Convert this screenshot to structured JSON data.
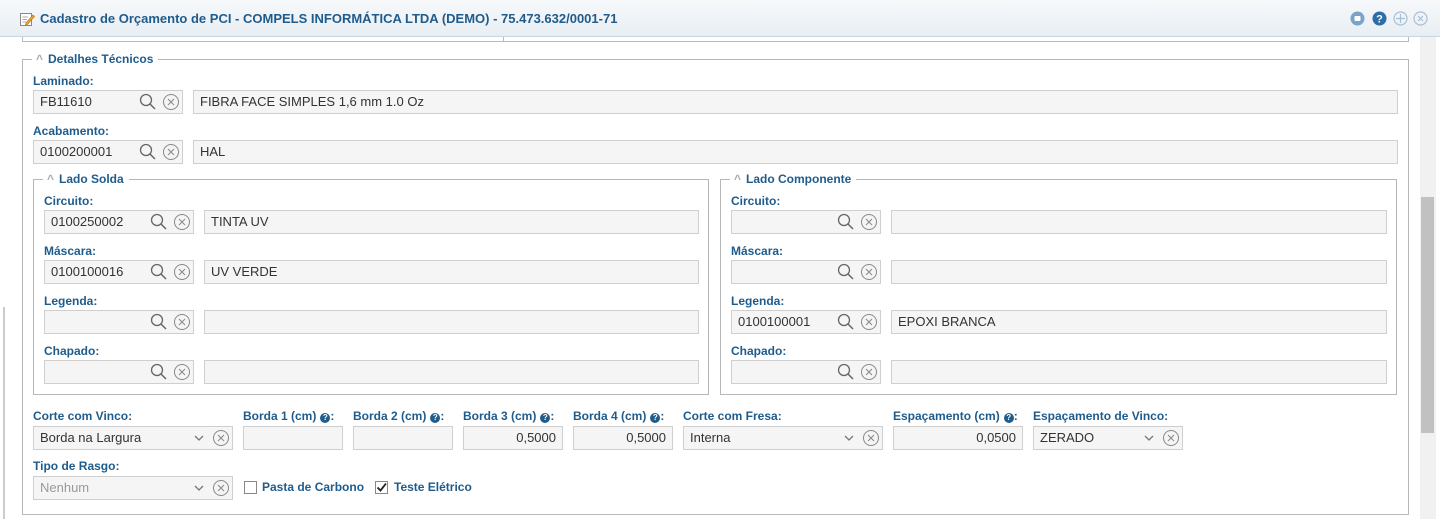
{
  "window": {
    "title": "Cadastro de Orçamento de PCI - COMPELS INFORMÁTICA LTDA (DEMO) - 75.473.632/0001-71"
  },
  "detalhes": {
    "legend": "Detalhes Técnicos",
    "laminado": {
      "label": "Laminado:",
      "code": "FB11610",
      "desc": "FIBRA FACE SIMPLES 1,6 mm 1.0 Oz"
    },
    "acabamento": {
      "label": "Acabamento:",
      "code": "0100200001",
      "desc": "HAL"
    }
  },
  "lado_solda": {
    "legend": "Lado Solda",
    "circuito": {
      "label": "Circuito:",
      "code": "0100250002",
      "desc": "TINTA UV"
    },
    "mascara": {
      "label": "Máscara:",
      "code": "0100100016",
      "desc": "UV VERDE"
    },
    "legenda": {
      "label": "Legenda:",
      "code": "",
      "desc": ""
    },
    "chapado": {
      "label": "Chapado:",
      "code": "",
      "desc": ""
    }
  },
  "lado_componente": {
    "legend": "Lado Componente",
    "circuito": {
      "label": "Circuito:",
      "code": "",
      "desc": ""
    },
    "mascara": {
      "label": "Máscara:",
      "code": "",
      "desc": ""
    },
    "legenda": {
      "label": "Legenda:",
      "code": "0100100001",
      "desc": "EPOXI BRANCA"
    },
    "chapado": {
      "label": "Chapado:",
      "code": "",
      "desc": ""
    }
  },
  "corte_vinco": {
    "label": "Corte com Vinco:",
    "value": "Borda na Largura"
  },
  "borda1": {
    "label": "Borda 1 (cm)",
    "value": ""
  },
  "borda2": {
    "label": "Borda 2 (cm)",
    "value": ""
  },
  "borda3": {
    "label": "Borda 3 (cm)",
    "value": "0,5000"
  },
  "borda4": {
    "label": "Borda 4 (cm)",
    "value": "0,5000"
  },
  "corte_fresa": {
    "label": "Corte com Fresa:",
    "value": "Interna"
  },
  "espacamento": {
    "label": "Espaçamento (cm)",
    "value": "0,0500"
  },
  "espacamento_vinco": {
    "label": "Espaçamento de Vinco:",
    "value": "ZERADO"
  },
  "tipo_rasgo": {
    "label": "Tipo de Rasgo:",
    "value": "Nenhum"
  },
  "pasta_carbono": {
    "label": "Pasta de Carbono",
    "checked": false
  },
  "teste_eletrico": {
    "label": "Teste Elétrico",
    "checked": true
  },
  "help_glyph": "?",
  "legend_chevron": "^",
  "colors": {
    "label_blue": "#1f5c8c",
    "field_bg": "#f5f5f5",
    "icon_blue": "#5b9bd5"
  }
}
